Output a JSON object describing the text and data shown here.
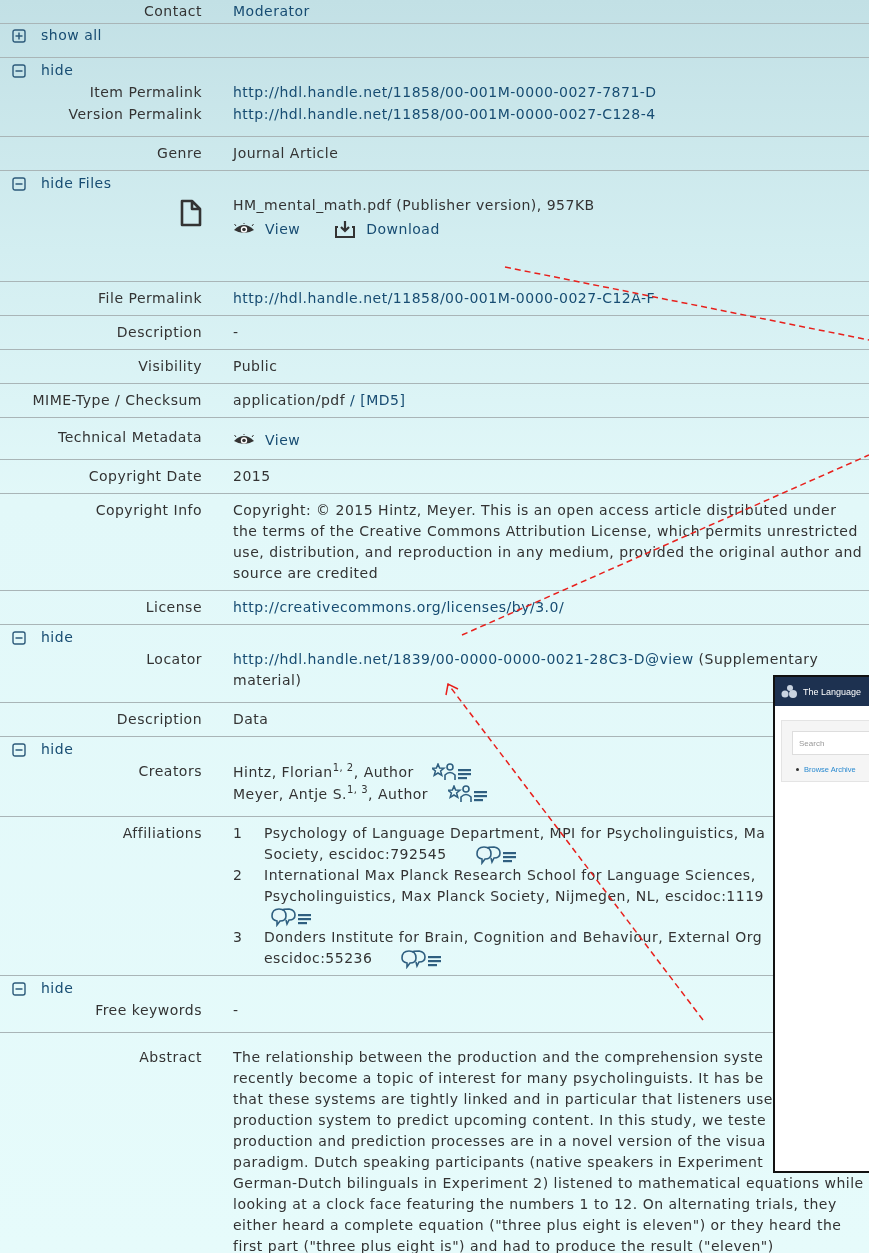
{
  "groups": [
    {
      "rows": [
        {
          "kind": "field",
          "label": "Contact",
          "value": [
            {
              "kind": "link",
              "text": "Moderator"
            }
          ]
        }
      ]
    },
    {
      "rows": [
        {
          "kind": "toggle",
          "collapsed": true,
          "text": "show all"
        }
      ]
    },
    {
      "rows": [
        {
          "kind": "toggle",
          "collapsed": false,
          "text": "hide"
        },
        {
          "kind": "field",
          "label": "Item Permalink",
          "value": [
            {
              "kind": "link",
              "text": "http://hdl.handle.net/11858/00-001M-0000-0027-7871-D"
            }
          ]
        },
        {
          "kind": "field",
          "label": "Version Permalink",
          "value": [
            {
              "kind": "link",
              "text": "http://hdl.handle.net/11858/00-001M-0000-0027-C128-4"
            }
          ]
        }
      ]
    },
    {
      "rows": [
        {
          "kind": "field",
          "label": "Genre",
          "value": [
            {
              "kind": "text",
              "text": "Journal Article"
            }
          ]
        }
      ]
    },
    {
      "rows": [
        {
          "kind": "toggle",
          "collapsed": false,
          "text": "hide Files"
        },
        {
          "kind": "file",
          "name": "HM_mental_math.pdf (Publisher version), 957KB",
          "actions": [
            {
              "kind": "view",
              "text": "View"
            },
            {
              "kind": "download",
              "text": "Download"
            }
          ]
        }
      ]
    },
    {
      "rows": [
        {
          "kind": "field",
          "label": "File Permalink",
          "value": [
            {
              "kind": "link",
              "text": "http://hdl.handle.net/11858/00-001M-0000-0027-C12A-F"
            }
          ]
        }
      ]
    },
    {
      "rows": [
        {
          "kind": "field",
          "label": "Description",
          "value": [
            {
              "kind": "text",
              "text": "-"
            }
          ]
        }
      ]
    },
    {
      "rows": [
        {
          "kind": "field",
          "label": "Visibility",
          "value": [
            {
              "kind": "text",
              "text": "Public"
            }
          ]
        }
      ]
    },
    {
      "rows": [
        {
          "kind": "field",
          "label": "MIME-Type / Checksum",
          "value": [
            {
              "kind": "text",
              "text": "application/pdf"
            },
            {
              "kind": "link",
              "text": "/ [MD5]"
            }
          ]
        }
      ]
    },
    {
      "rows": [
        {
          "kind": "action",
          "label": "Technical Metadata",
          "actions": [
            {
              "kind": "view",
              "text": "View"
            }
          ]
        }
      ]
    },
    {
      "rows": [
        {
          "kind": "field",
          "label": "Copyright Date",
          "value": [
            {
              "kind": "text",
              "text": "2015"
            }
          ]
        }
      ]
    },
    {
      "rows": [
        {
          "kind": "paragraph",
          "label": "Copyright Info",
          "lines": [
            "Copyright: © 2015 Hintz, Meyer. This is an open access article distributed under",
            "the terms of the Creative Commons Attribution License, which permits unrestricted",
            "use, distribution, and reproduction in any medium, provided the original author and",
            "source are credited"
          ]
        }
      ]
    },
    {
      "rows": [
        {
          "kind": "field",
          "label": "License",
          "value": [
            {
              "kind": "link",
              "text": "http://creativecommons.org/licenses/by/3.0/"
            }
          ]
        }
      ]
    },
    {
      "rows": [
        {
          "kind": "toggle",
          "collapsed": false,
          "text": "hide"
        },
        {
          "kind": "field",
          "label": "Locator",
          "value": [
            {
              "kind": "link",
              "text": "http://hdl.handle.net/1839/00-0000-0000-0021-28C3-D@view"
            },
            {
              "kind": "text",
              "text": "(Supplementary material)"
            }
          ]
        }
      ]
    },
    {
      "rows": [
        {
          "kind": "field",
          "label": "Description",
          "value": [
            {
              "kind": "text",
              "text": "Data"
            }
          ]
        }
      ]
    },
    {
      "rows": [
        {
          "kind": "toggle",
          "collapsed": false,
          "text": "hide"
        },
        {
          "kind": "creators",
          "label": "Creators",
          "creators": [
            {
              "text": "Hintz, Florian$^{1, 2}$, Author"
            },
            {
              "text": "Meyer, Antje S.$^{1, 3}$, Author"
            }
          ]
        }
      ]
    },
    {
      "rows": [
        {
          "kind": "affiliations",
          "label": "Affiliations",
          "affiliations": [
            {
              "number": "1",
              "lines": [
                "Psychology of Language Department, MPI for Psycholinguistics, Ma",
                "Society, escidoc:792545"
              ]
            },
            {
              "number": "2",
              "lines": [
                "International Max Planck Research School for Language Sciences,",
                "Psycholinguistics, Max Planck Society, Nijmegen, NL, escidoc:1119"
              ]
            },
            {
              "number": "3",
              "lines": [
                "Donders Institute for Brain, Cognition and Behaviour, External Org",
                "escidoc:55236"
              ]
            }
          ]
        }
      ]
    },
    {
      "rows": [
        {
          "kind": "toggle",
          "collapsed": false,
          "text": "hide"
        },
        {
          "kind": "field",
          "label": "Free keywords",
          "value": [
            {
              "kind": "text",
              "text": "-"
            }
          ]
        }
      ]
    },
    {
      "rows": [
        {
          "kind": "paragraph",
          "label": "Abstract",
          "lines": [
            "The relationship between the production and the comprehension syste",
            "recently become a topic of interest for many psycholinguists. It has be",
            "that these systems are tightly linked and in particular that listeners use",
            "production system to predict upcoming content. In this study, we teste",
            "production and prediction processes are in a novel version of the visua",
            "paradigm. Dutch speaking participants (native speakers in Experiment",
            "German-Dutch bilinguals in Experiment 2) listened to mathematical equations while",
            "looking at a clock face featuring the numbers 1 to 12. On alternating trials, they",
            "either heard a complete equation (\"three plus eight is eleven\") or they heard the",
            "first part (\"three plus eight is\") and had to produce the result (\"eleven\")"
          ]
        }
      ]
    }
  ],
  "embedded_window": {
    "title": "The Language",
    "search_placeholder": "Search",
    "links": [
      "Browse Archive"
    ]
  }
}
